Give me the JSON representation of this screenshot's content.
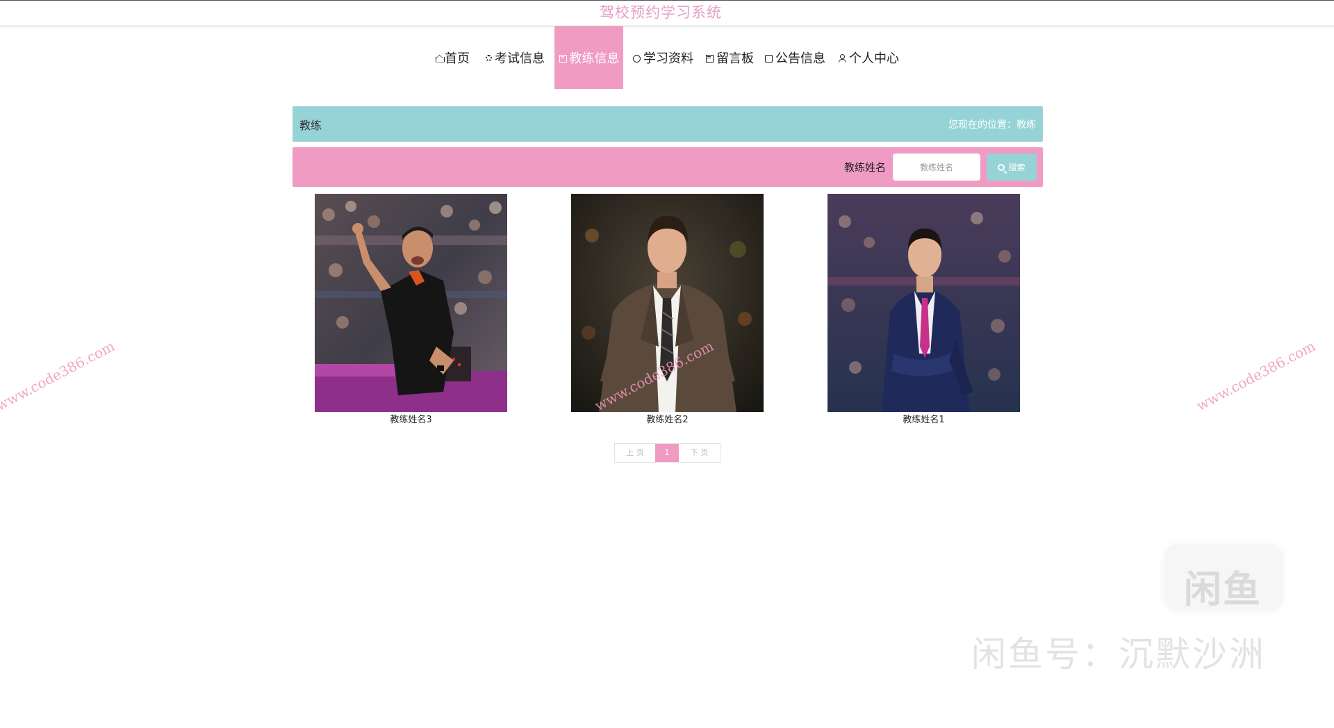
{
  "colors": {
    "pink": "#f09bc4",
    "blue": "#96d3d6",
    "title_pink": "#e89cc4"
  },
  "site": {
    "title": "驾校预约学习系统"
  },
  "nav": {
    "items": [
      {
        "label": "首页",
        "icon": "home-icon"
      },
      {
        "label": "考试信息",
        "icon": "gear-icon"
      },
      {
        "label": "教练信息",
        "icon": "coach-icon",
        "active": true
      },
      {
        "label": "学习资料",
        "icon": "circle-icon"
      },
      {
        "label": "留言板",
        "icon": "board-icon"
      },
      {
        "label": "公告信息",
        "icon": "note-icon"
      },
      {
        "label": "个人中心",
        "icon": "user-icon"
      }
    ]
  },
  "breadcrumb": {
    "section_title": "教练",
    "location_text": "您现在的位置：教练"
  },
  "search": {
    "label": "教练姓名",
    "placeholder": "教练姓名",
    "button_label": "搜索",
    "button_icon": "search-icon"
  },
  "coaches": [
    {
      "name": "教练姓名3"
    },
    {
      "name": "教练姓名2"
    },
    {
      "name": "教练姓名1"
    }
  ],
  "pagination": {
    "prev_label": "上 页",
    "current_page": "1",
    "next_label": "下 页"
  },
  "watermarks": {
    "site": "www.code386.com",
    "logo": "闲鱼",
    "handle": "闲鱼号：沉默沙洲"
  }
}
